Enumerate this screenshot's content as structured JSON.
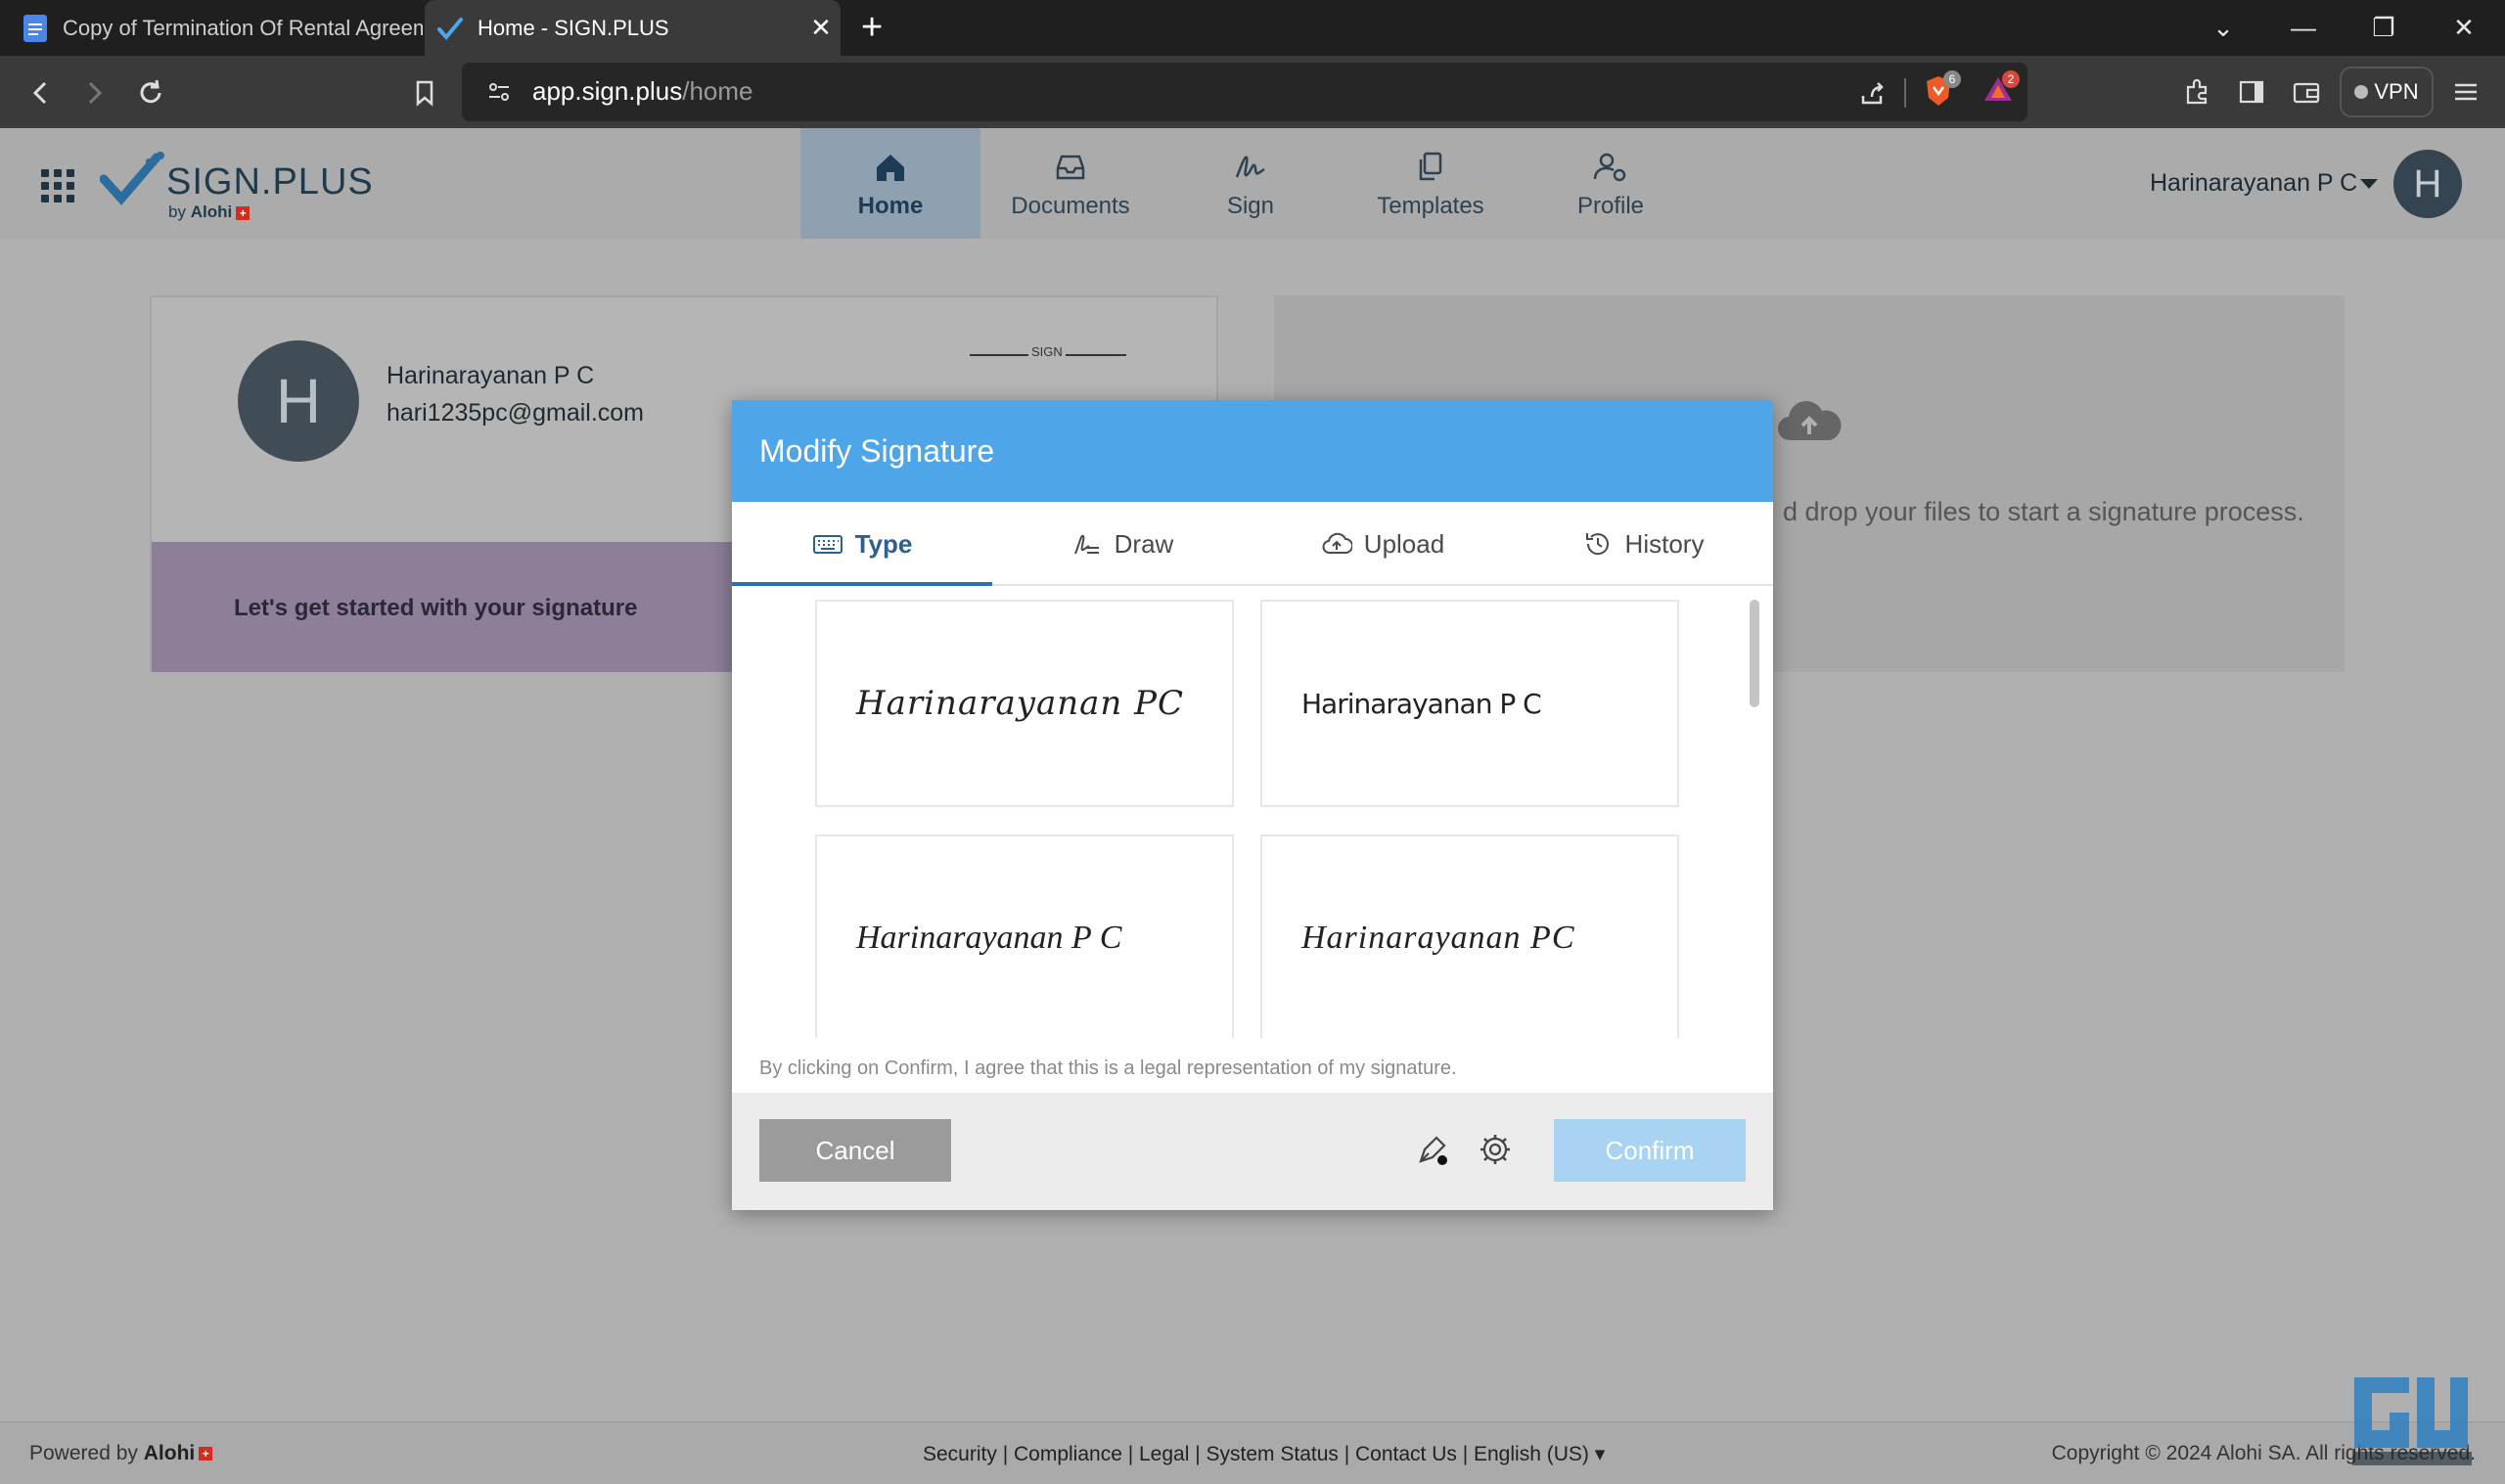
{
  "browser": {
    "tabs": [
      {
        "title": "Copy of Termination Of Rental Agreem",
        "active": false
      },
      {
        "title": "Home - SIGN.PLUS",
        "active": true
      }
    ],
    "new_tab": "+",
    "window_controls": {
      "list": "⌄",
      "minimize": "—",
      "restore": "❐",
      "close": "✕"
    },
    "url_host": "app.sign.plus",
    "url_path": "/home",
    "shields_count": "6",
    "rewards_count": "2",
    "vpn_label": "VPN"
  },
  "app": {
    "logo_word": "SIGN.PLUS",
    "logo_by": "by",
    "logo_by_brand": "Alohi",
    "nav": [
      {
        "label": "Home",
        "icon": "home-icon",
        "active": true
      },
      {
        "label": "Documents",
        "icon": "inbox-icon",
        "active": false
      },
      {
        "label": "Sign",
        "icon": "signature-icon",
        "active": false
      },
      {
        "label": "Templates",
        "icon": "copy-icon",
        "active": false
      },
      {
        "label": "Profile",
        "icon": "user-settings-icon",
        "active": false
      }
    ],
    "user_name": "Harinarayanan P C",
    "avatar_initial": "H"
  },
  "profile_card": {
    "initial": "H",
    "name": "Harinarayanan P C",
    "email": "hari1235pc@gmail.com",
    "preview_label": "SIGN",
    "cta": "Let's get started with your signature"
  },
  "upload_card": {
    "text": "d drop your files to start a signature process."
  },
  "footer": {
    "powered_by": "Powered by",
    "brand": "Alohi",
    "links": "Security | Compliance | Legal | System Status | Contact Us | English (US)",
    "copyright": "Copyright © 2024 Alohi SA. All rights reserved."
  },
  "modal": {
    "title": "Modify Signature",
    "tabs": [
      {
        "label": "Type",
        "icon": "keyboard-icon",
        "active": true
      },
      {
        "label": "Draw",
        "icon": "draw-icon",
        "active": false
      },
      {
        "label": "Upload",
        "icon": "cloud-upload-icon",
        "active": false
      },
      {
        "label": "History",
        "icon": "history-icon",
        "active": false
      }
    ],
    "signatures": [
      "Harinarayanan PC",
      "Harinarayanan P C",
      "Harinarayanan P C",
      "Harinarayanan PC"
    ],
    "legal": "By clicking on Confirm, I agree that this is a legal representation of my signature.",
    "cancel": "Cancel",
    "confirm": "Confirm"
  },
  "colors": {
    "modal_header": "#4ea6e8",
    "tab_active": "#2f5f8a",
    "confirm_disabled": "#a9d3f2",
    "cancel": "#9b9b9b"
  }
}
